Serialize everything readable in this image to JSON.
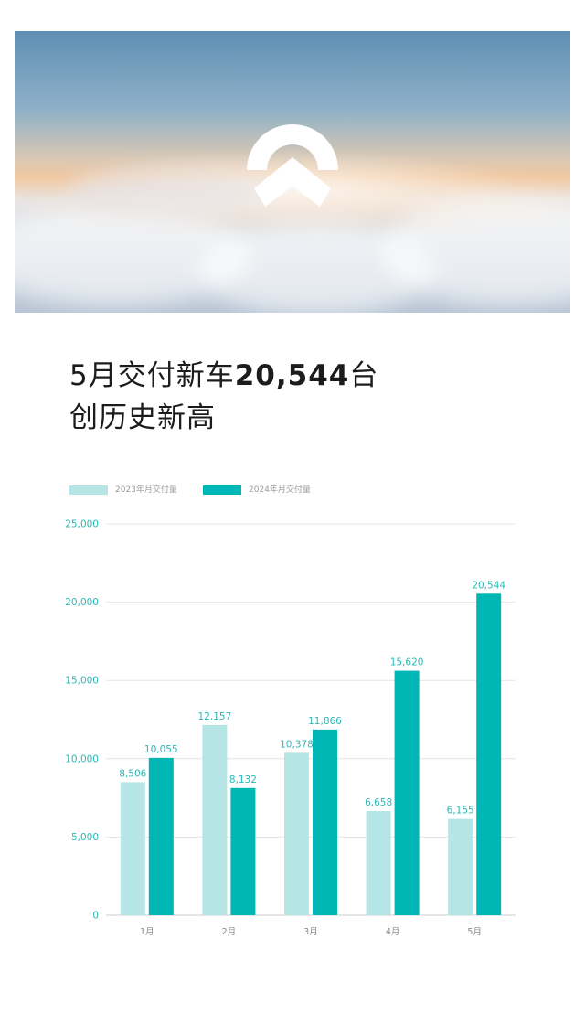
{
  "hero": {
    "logo": "nio-logo"
  },
  "headline": {
    "line1_prefix": "5月交付新车",
    "line1_number": "20,544",
    "line1_suffix": "台",
    "line2": "创历史新高"
  },
  "chart_data": {
    "type": "bar",
    "categories": [
      "1月",
      "2月",
      "3月",
      "4月",
      "5月"
    ],
    "series": [
      {
        "name": "2023年月交付量",
        "values": [
          8506,
          12157,
          10378,
          6658,
          6155
        ],
        "labels": [
          "8,506",
          "12,157",
          "10,378",
          "6,658",
          "6,155"
        ],
        "color": "#b5e6e5"
      },
      {
        "name": "2024年月交付量",
        "values": [
          10055,
          8132,
          11866,
          15620,
          20544
        ],
        "labels": [
          "10,055",
          "8,132",
          "11,866",
          "15,620",
          "20,544"
        ],
        "color": "#00b7b5"
      }
    ],
    "y_ticks": [
      "0",
      "5,000",
      "10,000",
      "15,000",
      "20,000",
      "25,000"
    ],
    "ylim": [
      0,
      25000
    ],
    "grid": true,
    "legend": "top-left",
    "title": "",
    "xlabel": "",
    "ylabel": ""
  }
}
